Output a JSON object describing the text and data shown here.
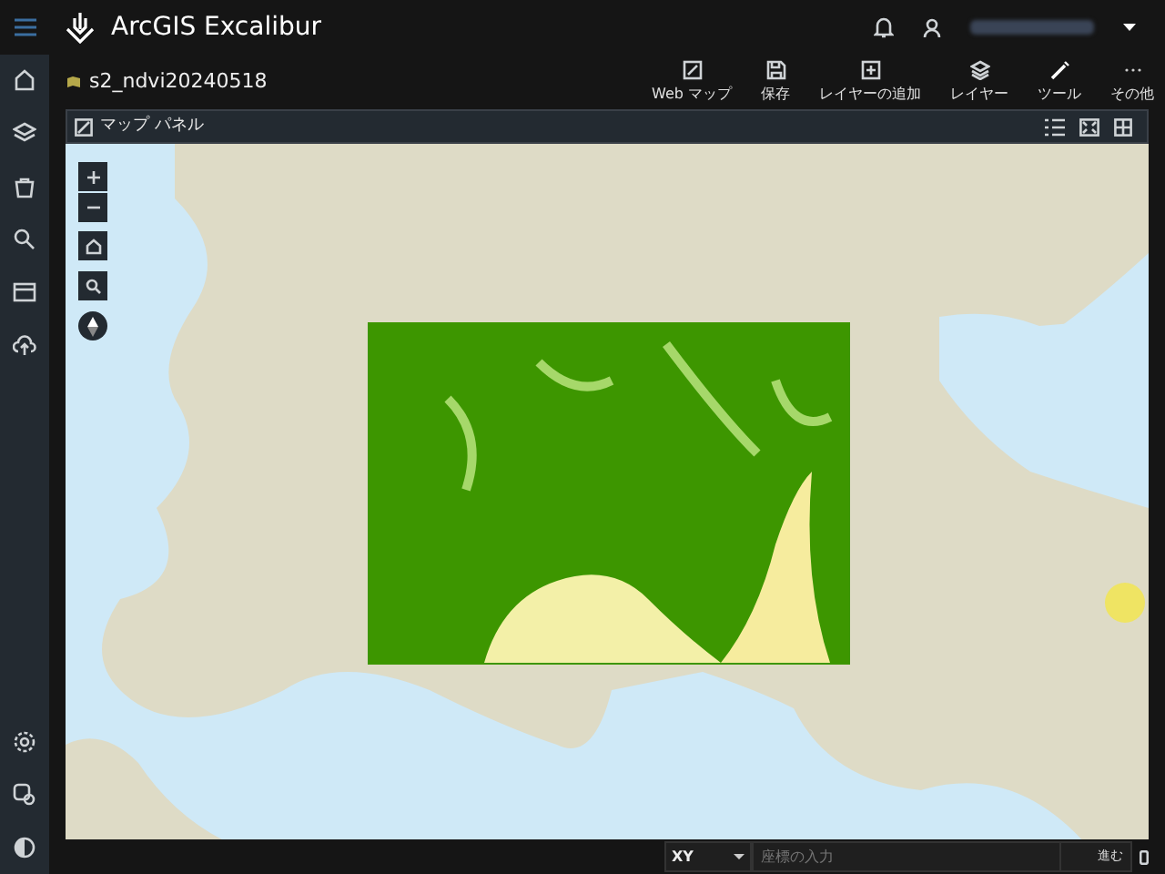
{
  "app": {
    "title": "ArcGIS Excalibur"
  },
  "item": {
    "title": "s2_ndvi20240518"
  },
  "toolbar": [
    {
      "label": "Web マップ",
      "kind": "webmap"
    },
    {
      "label": "保存",
      "kind": "save"
    },
    {
      "label": "レイヤーの追加",
      "kind": "add"
    },
    {
      "label": "レイヤー",
      "kind": "layers"
    },
    {
      "label": "ツール",
      "kind": "tools"
    },
    {
      "label": "その他",
      "kind": "more"
    }
  ],
  "map_panel": {
    "title": "マップ パネル"
  },
  "status_bar": {
    "coordinate_system": "XY",
    "placeholder": "座標の入力",
    "go_button": "進む"
  }
}
